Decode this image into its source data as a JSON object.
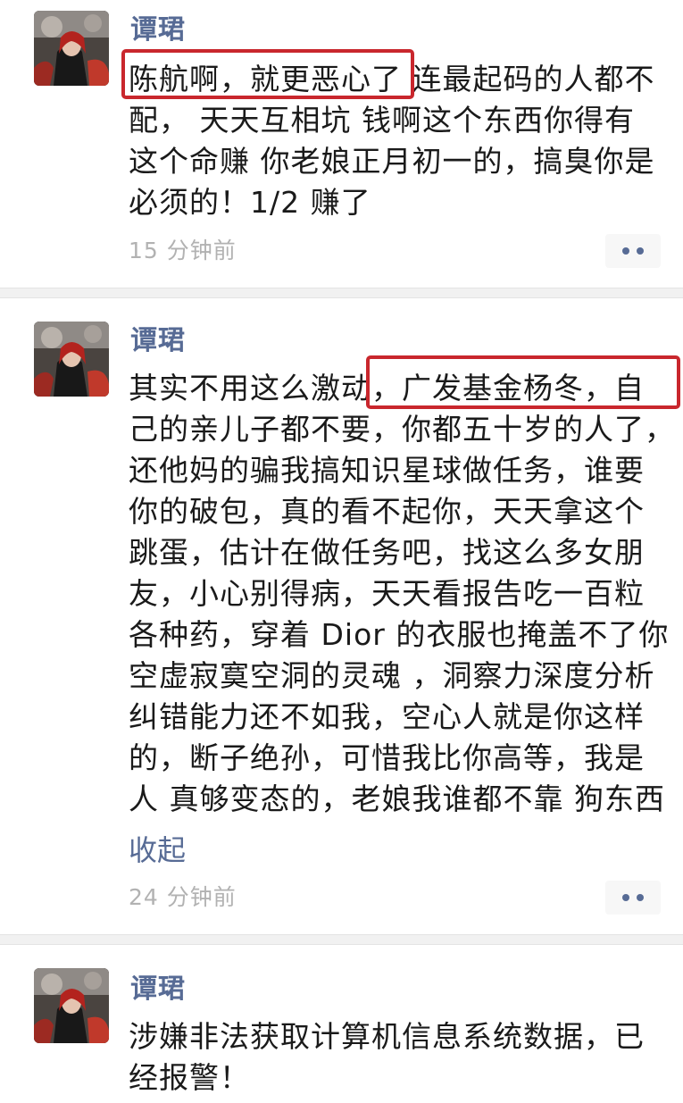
{
  "posts": [
    {
      "author": "谭珺",
      "lines": [
        "陈航啊，就更恶心了 连最起码的人都不",
        "配，  天天互相坑  钱啊这个东西你得有",
        "这个命赚 你老娘正月初一的，搞臭你是",
        "必须的！1/2 赚了"
      ],
      "timestamp": "15 分钟前"
    },
    {
      "author": "谭珺",
      "lines": [
        "其实不用这么激动，广发基金杨冬，自",
        "己的亲儿子都不要，你都五十岁的人了，",
        "还他妈的骗我搞知识星球做任务，谁要",
        "你的破包，真的看不起你，天天拿这个",
        "跳蛋，估计在做任务吧，找这么多女朋",
        "友，小心别得病，天天看报告吃一百粒",
        "各种药，穿着 Dior 的衣服也掩盖不了你",
        "空虚寂寞空洞的灵魂 ，洞察力深度分析",
        "纠错能力还不如我，空心人就是你这样",
        "的，断子绝孙，可惜我比你高等，我是",
        "人 真够变态的，老娘我谁都不靠  狗东西"
      ],
      "collapse_label": "收起",
      "timestamp": "24 分钟前"
    },
    {
      "author": "谭珺",
      "lines": [
        "涉嫌非法获取计算机信息系统数据，已",
        "经报警！"
      ]
    }
  ],
  "colors": {
    "author_name": "#576b95",
    "body_text": "#1a1a1a",
    "timestamp": "#b2b2b2",
    "highlight_box": "#c9272d",
    "divider": "#f1f1f1"
  },
  "icons": {
    "more": "more-dots-icon",
    "avatar": "avatar-photo"
  }
}
